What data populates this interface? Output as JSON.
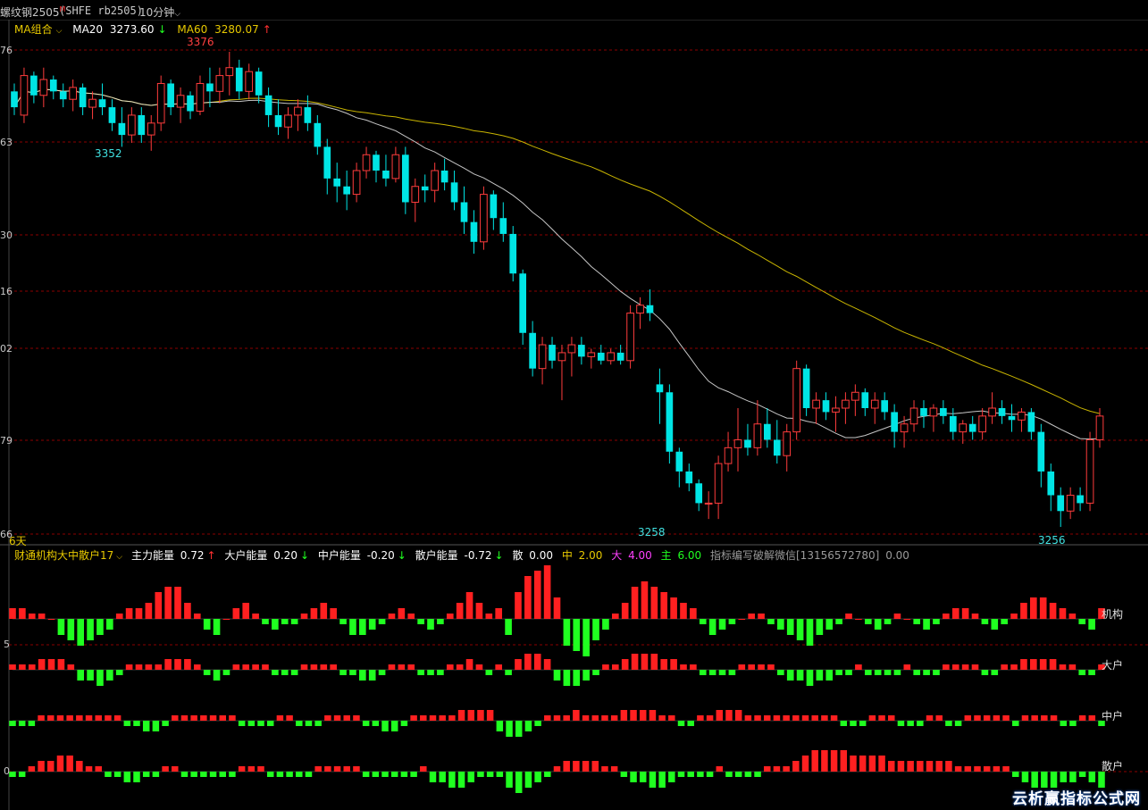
{
  "header": {
    "title": "螺纹钢2505",
    "title_sup": "M",
    "code": "(SHFE rb2505)",
    "period": "10分钟"
  },
  "ma_legend": {
    "group_label": "MA组合",
    "ma20_label": "MA20",
    "ma20_value": "3273.60",
    "ma20_arrow": "↓",
    "ma60_label": "MA60",
    "ma60_value": "3280.07",
    "ma60_arrow": "↑"
  },
  "y_axis_labels": [
    "76",
    "63",
    "30",
    "16",
    "02",
    "79",
    "66"
  ],
  "bottom_left_label": "6天",
  "price_annotations": {
    "high_label": "3376",
    "low_left_label": "3352",
    "low_mid_label": "3258",
    "low_right_label": "3256"
  },
  "indicator_legend": {
    "name": "财通机构大中散户17",
    "main_energy_label": "主力能量",
    "main_energy_value": "0.72",
    "main_energy_arrow": "↑",
    "big_energy_label": "大户能量",
    "big_energy_value": "0.20",
    "big_energy_arrow": "↓",
    "mid_energy_label": "中户能量",
    "mid_energy_value": "-0.20",
    "mid_energy_arrow": "↓",
    "retail_energy_label": "散户能量",
    "retail_energy_value": "-0.72",
    "retail_energy_arrow": "↓",
    "san_label": "散",
    "san_value": "0.00",
    "zhong_label": "中",
    "zhong_value": "2.00",
    "da_label": "大",
    "da_value": "4.00",
    "zhu_label": "主",
    "zhu_value": "6.00",
    "note": "指标编写破解微信[13156572780]",
    "note_value": "0.00"
  },
  "indicator_y_labels": [
    "5",
    "0"
  ],
  "row_labels": [
    "机构",
    "大户",
    "中户",
    "散户"
  ],
  "watermark": "云析赢指标公式网",
  "colors": {
    "up": "#ff3c3c",
    "down": "#00e5e5",
    "ma20": "#e8e8e8",
    "ma60": "#c8b400",
    "bar_pos": "#ff2020",
    "bar_neg": "#20ff20",
    "grid": "#8b0000",
    "legend_yellow": "#e6c800",
    "legend_magenta": "#ff40ff",
    "legend_green": "#20ff20"
  },
  "chart_data": {
    "type": "candlestick",
    "instrument": "螺纹钢2505",
    "labeled_extremes": {
      "high": 3376,
      "lows": [
        3352,
        3258,
        3256
      ]
    },
    "ma20_last": 3273.6,
    "ma60_last": 3280.07,
    "candles": [
      [
        3366,
        3368,
        3360,
        3362
      ],
      [
        3360,
        3372,
        3358,
        3370
      ],
      [
        3370,
        3371,
        3363,
        3365
      ],
      [
        3365,
        3372,
        3362,
        3369
      ],
      [
        3369,
        3370,
        3364,
        3366
      ],
      [
        3366,
        3368,
        3362,
        3364
      ],
      [
        3364,
        3369,
        3361,
        3367
      ],
      [
        3367,
        3368,
        3360,
        3362
      ],
      [
        3362,
        3366,
        3359,
        3364
      ],
      [
        3364,
        3368,
        3360,
        3362
      ],
      [
        3362,
        3364,
        3356,
        3358
      ],
      [
        3358,
        3362,
        3352,
        3355
      ],
      [
        3355,
        3362,
        3353,
        3360
      ],
      [
        3360,
        3362,
        3353,
        3355
      ],
      [
        3355,
        3360,
        3351,
        3358
      ],
      [
        3358,
        3370,
        3356,
        3368
      ],
      [
        3368,
        3369,
        3360,
        3362
      ],
      [
        3362,
        3367,
        3358,
        3365
      ],
      [
        3365,
        3366,
        3359,
        3361
      ],
      [
        3361,
        3370,
        3360,
        3368
      ],
      [
        3368,
        3372,
        3362,
        3366
      ],
      [
        3366,
        3372,
        3363,
        3370
      ],
      [
        3370,
        3376,
        3365,
        3372
      ],
      [
        3372,
        3374,
        3364,
        3366
      ],
      [
        3366,
        3373,
        3364,
        3371
      ],
      [
        3371,
        3372,
        3363,
        3365
      ],
      [
        3365,
        3367,
        3357,
        3360
      ],
      [
        3360,
        3364,
        3355,
        3357
      ],
      [
        3357,
        3362,
        3354,
        3360
      ],
      [
        3360,
        3364,
        3356,
        3362
      ],
      [
        3362,
        3365,
        3356,
        3358
      ],
      [
        3358,
        3360,
        3350,
        3352
      ],
      [
        3352,
        3354,
        3340,
        3344
      ],
      [
        3344,
        3348,
        3338,
        3342
      ],
      [
        3342,
        3346,
        3336,
        3340
      ],
      [
        3340,
        3348,
        3338,
        3346
      ],
      [
        3346,
        3352,
        3344,
        3350
      ],
      [
        3350,
        3351,
        3343,
        3346
      ],
      [
        3346,
        3350,
        3342,
        3344
      ],
      [
        3344,
        3352,
        3343,
        3350
      ],
      [
        3350,
        3352,
        3335,
        3338
      ],
      [
        3338,
        3344,
        3333,
        3342
      ],
      [
        3342,
        3345,
        3338,
        3341
      ],
      [
        3341,
        3348,
        3338,
        3346
      ],
      [
        3346,
        3349,
        3341,
        3343
      ],
      [
        3343,
        3346,
        3336,
        3338
      ],
      [
        3338,
        3342,
        3330,
        3333
      ],
      [
        3333,
        3336,
        3325,
        3328
      ],
      [
        3328,
        3342,
        3326,
        3340
      ],
      [
        3340,
        3341,
        3331,
        3334
      ],
      [
        3334,
        3338,
        3328,
        3330
      ],
      [
        3330,
        3332,
        3318,
        3320
      ],
      [
        3320,
        3321,
        3302,
        3305
      ],
      [
        3305,
        3308,
        3294,
        3296
      ],
      [
        3296,
        3304,
        3292,
        3302
      ],
      [
        3302,
        3304,
        3296,
        3298
      ],
      [
        3298,
        3302,
        3288,
        3300
      ],
      [
        3300,
        3304,
        3294,
        3302
      ],
      [
        3302,
        3304,
        3297,
        3299
      ],
      [
        3299,
        3301,
        3296,
        3300
      ],
      [
        3300,
        3302,
        3297,
        3298
      ],
      [
        3298,
        3301,
        3297,
        3300
      ],
      [
        3300,
        3302,
        3297,
        3298
      ],
      [
        3298,
        3312,
        3296,
        3310
      ],
      [
        3310,
        3314,
        3306,
        3312
      ],
      [
        3312,
        3316,
        3308,
        3310
      ],
      [
        3292,
        3296,
        3282,
        3290
      ],
      [
        3290,
        3292,
        3272,
        3275
      ],
      [
        3275,
        3276,
        3266,
        3270
      ],
      [
        3270,
        3272,
        3265,
        3267
      ],
      [
        3267,
        3268,
        3260,
        3262
      ],
      [
        3262,
        3265,
        3258,
        3262
      ],
      [
        3262,
        3274,
        3258,
        3272
      ],
      [
        3272,
        3280,
        3270,
        3276
      ],
      [
        3276,
        3286,
        3270,
        3278
      ],
      [
        3278,
        3282,
        3274,
        3276
      ],
      [
        3276,
        3288,
        3274,
        3282
      ],
      [
        3282,
        3286,
        3276,
        3278
      ],
      [
        3278,
        3283,
        3272,
        3274
      ],
      [
        3274,
        3282,
        3270,
        3280
      ],
      [
        3280,
        3298,
        3278,
        3296
      ],
      [
        3296,
        3297,
        3284,
        3286
      ],
      [
        3286,
        3290,
        3282,
        3288
      ],
      [
        3288,
        3290,
        3283,
        3285
      ],
      [
        3285,
        3289,
        3280,
        3286
      ],
      [
        3286,
        3290,
        3282,
        3288
      ],
      [
        3288,
        3292,
        3284,
        3290
      ],
      [
        3290,
        3291,
        3284,
        3286
      ],
      [
        3286,
        3290,
        3282,
        3288
      ],
      [
        3288,
        3290,
        3283,
        3285
      ],
      [
        3285,
        3287,
        3276,
        3280
      ],
      [
        3280,
        3284,
        3276,
        3282
      ],
      [
        3282,
        3288,
        3280,
        3286
      ],
      [
        3286,
        3288,
        3281,
        3284
      ],
      [
        3284,
        3287,
        3280,
        3286
      ],
      [
        3286,
        3288,
        3282,
        3284
      ],
      [
        3284,
        3286,
        3278,
        3280
      ],
      [
        3280,
        3283,
        3277,
        3282
      ],
      [
        3282,
        3284,
        3278,
        3280
      ],
      [
        3280,
        3286,
        3278,
        3284
      ],
      [
        3284,
        3290,
        3282,
        3286
      ],
      [
        3286,
        3288,
        3282,
        3284
      ],
      [
        3284,
        3287,
        3280,
        3283
      ],
      [
        3283,
        3286,
        3280,
        3285
      ],
      [
        3285,
        3286,
        3278,
        3280
      ],
      [
        3280,
        3282,
        3266,
        3270
      ],
      [
        3270,
        3272,
        3260,
        3264
      ],
      [
        3264,
        3266,
        3256,
        3260
      ],
      [
        3260,
        3266,
        3258,
        3264
      ],
      [
        3264,
        3266,
        3260,
        3262
      ],
      [
        3262,
        3280,
        3260,
        3278
      ],
      [
        3278,
        3286,
        3276,
        3284
      ]
    ],
    "indicator": {
      "series": [
        {
          "name": "机构",
          "values": [
            2,
            2,
            1,
            1,
            0,
            -3,
            -4,
            -5,
            -4,
            -3,
            -2,
            1,
            2,
            2,
            3,
            5,
            6,
            6,
            3,
            1,
            -2,
            -3,
            0,
            2,
            3,
            1,
            -1,
            -2,
            -1,
            -1,
            1,
            2,
            3,
            2,
            -1,
            -3,
            -3,
            -2,
            -1,
            1,
            2,
            1,
            -1,
            -2,
            -1,
            1,
            3,
            5,
            3,
            1,
            2,
            -3,
            5,
            8,
            9,
            10,
            4,
            -5,
            -6,
            -7,
            -4,
            -2,
            1,
            3,
            6,
            7,
            6,
            5,
            4,
            3,
            2,
            -1,
            -3,
            -2,
            -1,
            0,
            1,
            1,
            -1,
            -2,
            -3,
            -4,
            -5,
            -3,
            -2,
            -1,
            1,
            0,
            -1,
            -2,
            -1,
            1,
            0,
            -1,
            -2,
            -1,
            1,
            2,
            2,
            1,
            -1,
            -2,
            -1,
            1,
            3,
            4,
            4,
            3,
            2,
            1,
            -1,
            -2,
            2
          ]
        },
        {
          "name": "大户",
          "values": [
            1,
            1,
            1,
            2,
            2,
            2,
            1,
            -2,
            -2,
            -3,
            -2,
            -1,
            1,
            1,
            1,
            1,
            2,
            2,
            2,
            1,
            -1,
            -2,
            -1,
            1,
            1,
            1,
            1,
            -1,
            -1,
            -1,
            1,
            1,
            1,
            1,
            -1,
            -1,
            -2,
            -2,
            -1,
            1,
            1,
            1,
            -1,
            -1,
            -1,
            1,
            1,
            2,
            1,
            -1,
            1,
            -1,
            2,
            3,
            3,
            2,
            -2,
            -3,
            -3,
            -2,
            -1,
            1,
            1,
            2,
            3,
            3,
            3,
            2,
            2,
            1,
            1,
            -1,
            -1,
            -1,
            -1,
            1,
            1,
            1,
            1,
            -1,
            -2,
            -2,
            -3,
            -2,
            -2,
            -1,
            -1,
            1,
            -1,
            -1,
            -1,
            -1,
            1,
            -1,
            -1,
            -1,
            1,
            1,
            1,
            1,
            -1,
            -1,
            1,
            1,
            2,
            2,
            2,
            2,
            1,
            1,
            -1,
            -1,
            1
          ]
        },
        {
          "name": "中户",
          "values": [
            -1,
            -1,
            -1,
            1,
            1,
            1,
            1,
            1,
            1,
            1,
            1,
            1,
            -1,
            -1,
            -2,
            -2,
            -1,
            1,
            1,
            1,
            1,
            1,
            1,
            1,
            -1,
            -1,
            -1,
            -1,
            1,
            1,
            -1,
            -1,
            -1,
            1,
            1,
            1,
            1,
            -1,
            -1,
            -2,
            -2,
            -1,
            1,
            1,
            1,
            1,
            1,
            2,
            2,
            2,
            2,
            -2,
            -3,
            -3,
            -2,
            -1,
            1,
            1,
            1,
            2,
            1,
            1,
            1,
            1,
            2,
            2,
            2,
            2,
            1,
            1,
            -1,
            -1,
            1,
            1,
            2,
            2,
            2,
            1,
            1,
            1,
            1,
            1,
            1,
            1,
            1,
            1,
            1,
            -1,
            -1,
            -1,
            1,
            1,
            1,
            -1,
            -1,
            -1,
            1,
            1,
            -1,
            -1,
            1,
            1,
            1,
            1,
            1,
            -1,
            1,
            1,
            1,
            1,
            -1,
            -1,
            1,
            1,
            -1
          ]
        },
        {
          "name": "散户",
          "values": [
            -1,
            -1,
            1,
            2,
            2,
            3,
            3,
            2,
            1,
            1,
            -1,
            -1,
            -2,
            -2,
            -1,
            -1,
            1,
            1,
            -1,
            -1,
            -1,
            -1,
            -1,
            -1,
            1,
            1,
            1,
            -1,
            -1,
            -1,
            -1,
            -1,
            1,
            1,
            1,
            1,
            1,
            -1,
            -1,
            -1,
            -1,
            -1,
            -1,
            1,
            -2,
            -2,
            -3,
            -3,
            -2,
            -1,
            -1,
            -1,
            -3,
            -4,
            -3,
            -2,
            -1,
            1,
            2,
            2,
            2,
            2,
            1,
            1,
            -1,
            -2,
            -2,
            -3,
            -3,
            -2,
            -1,
            -1,
            -1,
            -1,
            1,
            -1,
            -1,
            -1,
            -1,
            1,
            1,
            1,
            2,
            3,
            4,
            4,
            4,
            4,
            3,
            3,
            3,
            3,
            2,
            2,
            2,
            2,
            2,
            2,
            2,
            1,
            1,
            1,
            1,
            1,
            1,
            -1,
            -2,
            -3,
            -3,
            -3,
            -2,
            -2,
            -1,
            -2,
            -3
          ]
        }
      ]
    }
  }
}
